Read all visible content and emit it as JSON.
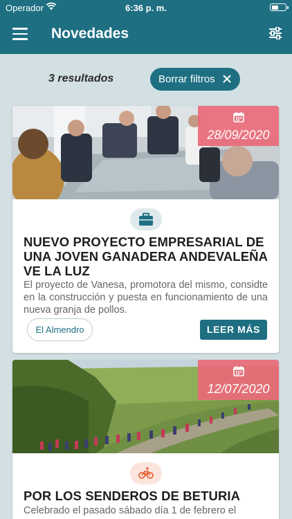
{
  "status": {
    "carrier": "Operador",
    "time": "6:36 p. m."
  },
  "header": {
    "title": "Novedades",
    "menu_icon": "hamburger-menu-icon",
    "filter_icon": "sliders-filter-icon"
  },
  "filters": {
    "results_text": "3 resultados",
    "clear_label": "Borrar filtros",
    "clear_icon": "close-icon"
  },
  "news": [
    {
      "date": "28/09/2020",
      "category_icon": "briefcase-icon",
      "category_color": "#1e6f82",
      "title": "NUEVO PROYECTO EMPRESARIAL DE UNA JOVEN GANADERA ANDEVALEÑA VE LA LUZ",
      "description": "El proyecto de Vanesa, promotora del mismo, considte en la construcción y puesta en funcionamiento de una nueva granja de pollos.",
      "place": "El Almendro",
      "more_label": "LEER MÁS"
    },
    {
      "date": "12/07/2020",
      "category_icon": "bicycle-icon",
      "category_color": "#e8663d",
      "title": "POR LOS SENDEROS DE BETURIA",
      "description": "Celebrado el pasado sábado día 1 de febrero el"
    }
  ],
  "colors": {
    "primary": "#1e6f82",
    "background": "#d3e0e3",
    "date_badge": "#e96a78"
  }
}
